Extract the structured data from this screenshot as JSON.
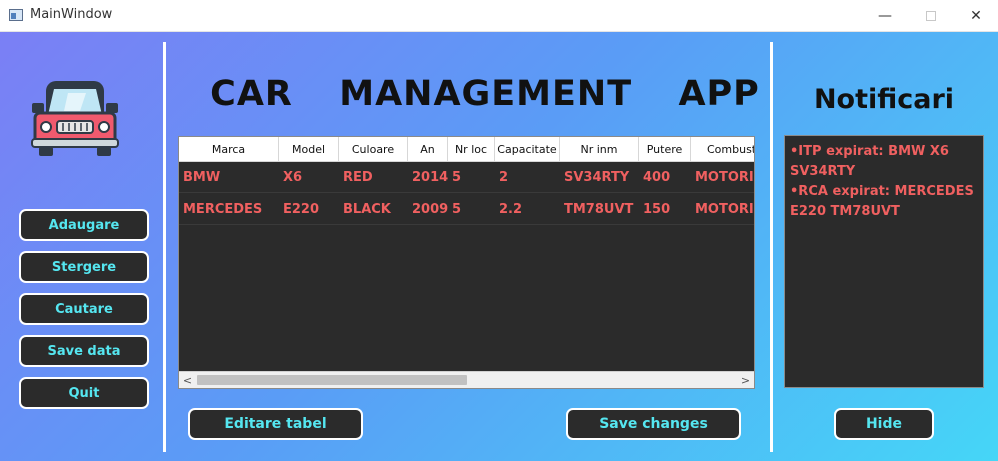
{
  "window": {
    "title": "MainWindow",
    "minimize_glyph": "—",
    "close_glyph": "✕"
  },
  "sidebar": {
    "buttons": [
      "Adaugare",
      "Stergere",
      "Cautare",
      "Save data",
      "Quit"
    ]
  },
  "main": {
    "title": "CAR  MANAGEMENT  APP"
  },
  "table": {
    "columns": [
      "Marca",
      "Model",
      "Culoare",
      "An",
      "Nr loc",
      "Capacitate",
      "Nr inm",
      "Putere",
      "Combust"
    ],
    "rows": [
      [
        "BMW",
        "X6",
        "RED",
        "2014",
        "5",
        "2",
        "SV34RTY",
        "400",
        "MOTORINA"
      ],
      [
        "MERCEDES",
        "E220",
        "BLACK",
        "2009",
        "5",
        "2.2",
        "TM78UVT",
        "150",
        "MOTORINA"
      ]
    ],
    "scroll_left_glyph": "<",
    "scroll_right_glyph": ">"
  },
  "actions": {
    "edit_label": "Editare tabel",
    "save_label": "Save changes"
  },
  "notifications": {
    "title": "Notificari",
    "items": [
      "•ITP expirat: BMW X6 SV34RTY",
      "•RCA expirat: MERCEDES E220 TM78UVT"
    ],
    "hide_label": "Hide"
  },
  "colors": {
    "accent_text": "#55e6f0",
    "data_text": "#f06060",
    "panel_bg": "#2b2b2b",
    "car_body": "#f05a6e"
  },
  "icons": {
    "app": "window-app-icon",
    "car": "car-icon"
  }
}
